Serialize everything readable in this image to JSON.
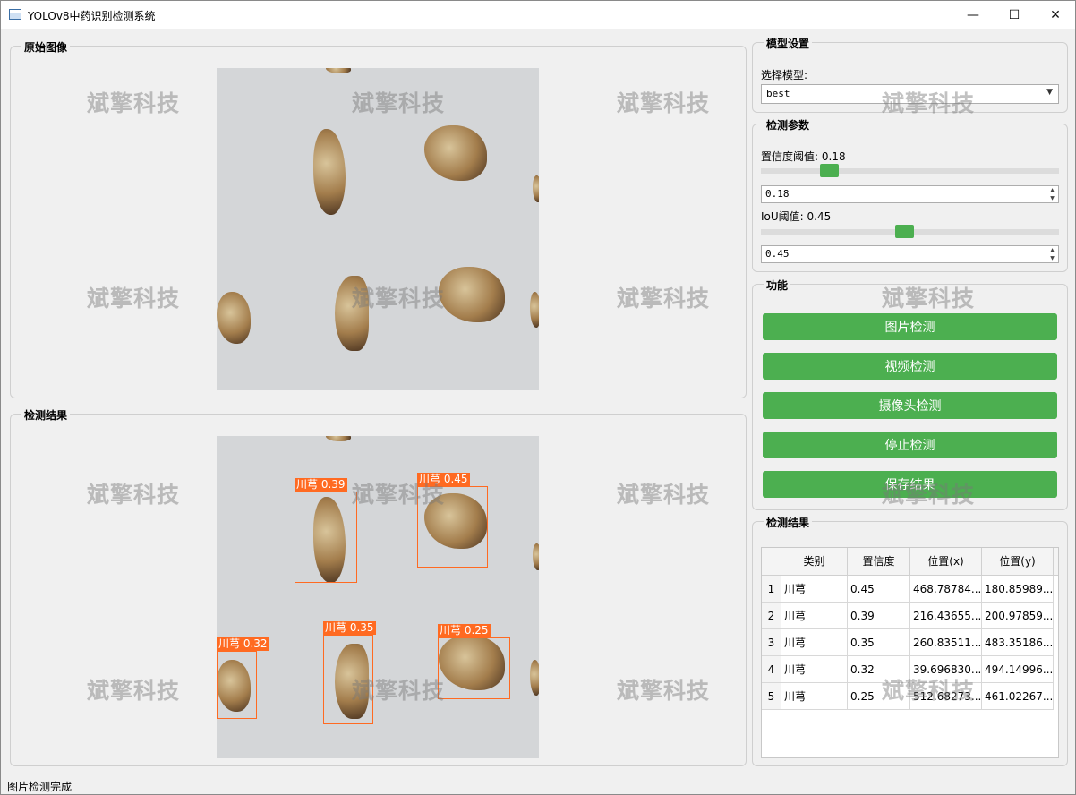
{
  "window": {
    "title": "YOLOv8中药识别检测系统",
    "minimize": "—",
    "maximize": "☐",
    "close": "✕"
  },
  "original_image": {
    "title": "原始图像"
  },
  "result_image": {
    "title": "检测结果",
    "detections": [
      {
        "label": "川芎 0.39"
      },
      {
        "label": "川芎 0.45"
      },
      {
        "label": "川芎 0.32"
      },
      {
        "label": "川芎 0.35"
      },
      {
        "label": "川芎 0.25"
      }
    ]
  },
  "model_settings": {
    "title": "模型设置",
    "select_label": "选择模型:",
    "selected": "best"
  },
  "detect_params": {
    "title": "检测参数",
    "conf_label": "置信度阈值: 0.18",
    "conf_value": "0.18",
    "conf_level": 0.18,
    "iou_label": "IoU阈值: 0.45",
    "iou_value": "0.45",
    "iou_level": 0.45
  },
  "functions": {
    "title": "功能",
    "image_detect": "图片检测",
    "video_detect": "视频检测",
    "camera_detect": "摄像头检测",
    "stop_detect": "停止检测",
    "save_result": "保存结果"
  },
  "results_table": {
    "title": "检测结果",
    "columns": [
      "类别",
      "置信度",
      "位置(x)",
      "位置(y)"
    ],
    "rows": [
      {
        "index": "1",
        "cls": "川芎",
        "conf": "0.45",
        "x": "468.78784...",
        "y": "180.85989..."
      },
      {
        "index": "2",
        "cls": "川芎",
        "conf": "0.39",
        "x": "216.43655...",
        "y": "200.97859..."
      },
      {
        "index": "3",
        "cls": "川芎",
        "conf": "0.35",
        "x": "260.83511...",
        "y": "483.35186..."
      },
      {
        "index": "4",
        "cls": "川芎",
        "conf": "0.32",
        "x": "39.696830...",
        "y": "494.14996..."
      },
      {
        "index": "5",
        "cls": "川芎",
        "conf": "0.25",
        "x": "512.68273...",
        "y": "461.02267..."
      }
    ]
  },
  "watermark": "斌擎科技",
  "status": "图片检测完成"
}
